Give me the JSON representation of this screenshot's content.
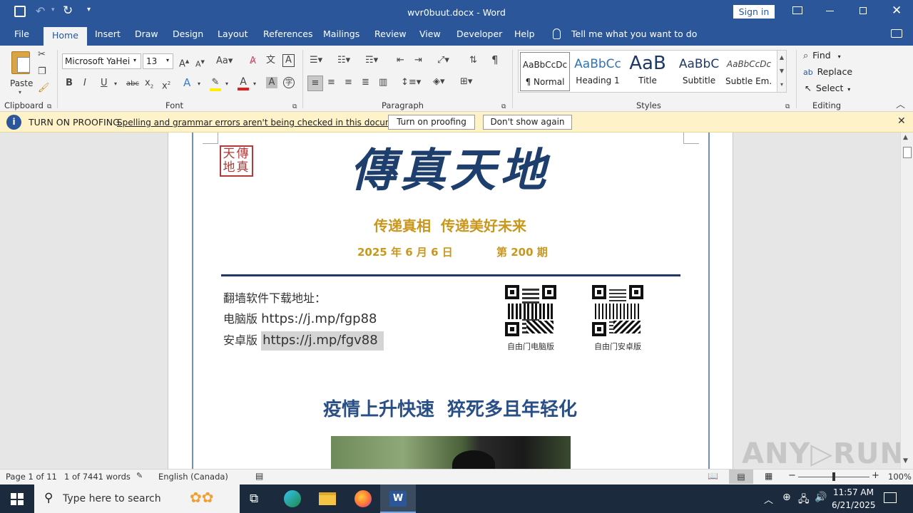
{
  "window": {
    "doc_title": "wvr0buut.docx",
    "separator": "-",
    "app_name": "Word",
    "sign_in": "Sign in"
  },
  "tabs": [
    "File",
    "Home",
    "Insert",
    "Draw",
    "Design",
    "Layout",
    "References",
    "Mailings",
    "Review",
    "View",
    "Developer",
    "Help"
  ],
  "tell_me": "Tell me what you want to do",
  "ribbon": {
    "clipboard": {
      "paste": "Paste",
      "label": "Clipboard"
    },
    "font": {
      "name": "Microsoft YaHei",
      "size": "13",
      "label": "Font"
    },
    "paragraph": {
      "label": "Paragraph"
    },
    "styles": {
      "label": "Styles",
      "items": [
        {
          "preview": "AaBbCcDc",
          "name": "¶ Normal"
        },
        {
          "preview": "AaBbCc",
          "name": "Heading 1"
        },
        {
          "preview": "AaB",
          "name": "Title"
        },
        {
          "preview": "AaBbC",
          "name": "Subtitle"
        },
        {
          "preview": "AaBbCcDc",
          "name": "Subtle Em..."
        }
      ]
    },
    "editing": {
      "find": "Find",
      "replace": "Replace",
      "select": "Select",
      "label": "Editing"
    }
  },
  "infobar": {
    "title": "TURN ON PROOFING",
    "message": "Spelling and grammar errors aren't being checked in this document.",
    "btn_turn_on": "Turn on proofing",
    "btn_dont_show": "Don't show again"
  },
  "document": {
    "seal_text": "天傳地真",
    "masthead": "傳真天地",
    "slogan": "传递真相  传递美好未来",
    "date": "2025 年 6 月 6 日",
    "issue": "第 200 期",
    "download_heading": "翻墙软件下载地址：",
    "pc_label": "电脑版",
    "pc_url": "https://j.mp/fgp88",
    "android_label": "安卓版",
    "android_url": "https://j.mp/fgv88",
    "qr1_caption": "自由门电脑版",
    "qr2_caption": "自由门安卓版",
    "headline": "疫情上升快速  猝死多且年轻化"
  },
  "status": {
    "page": "Page 1 of 11",
    "words": "1 of 7441 words",
    "language": "English (Canada)",
    "zoom": "100%"
  },
  "taskbar": {
    "search_placeholder": "Type here to search",
    "time": "11:57 AM",
    "date": "6/21/2025"
  },
  "colors": {
    "word_blue": "#2b579a",
    "masthead_blue": "#1e3f6e",
    "gold": "#c9971c",
    "headline_blue": "#2a4f86"
  }
}
